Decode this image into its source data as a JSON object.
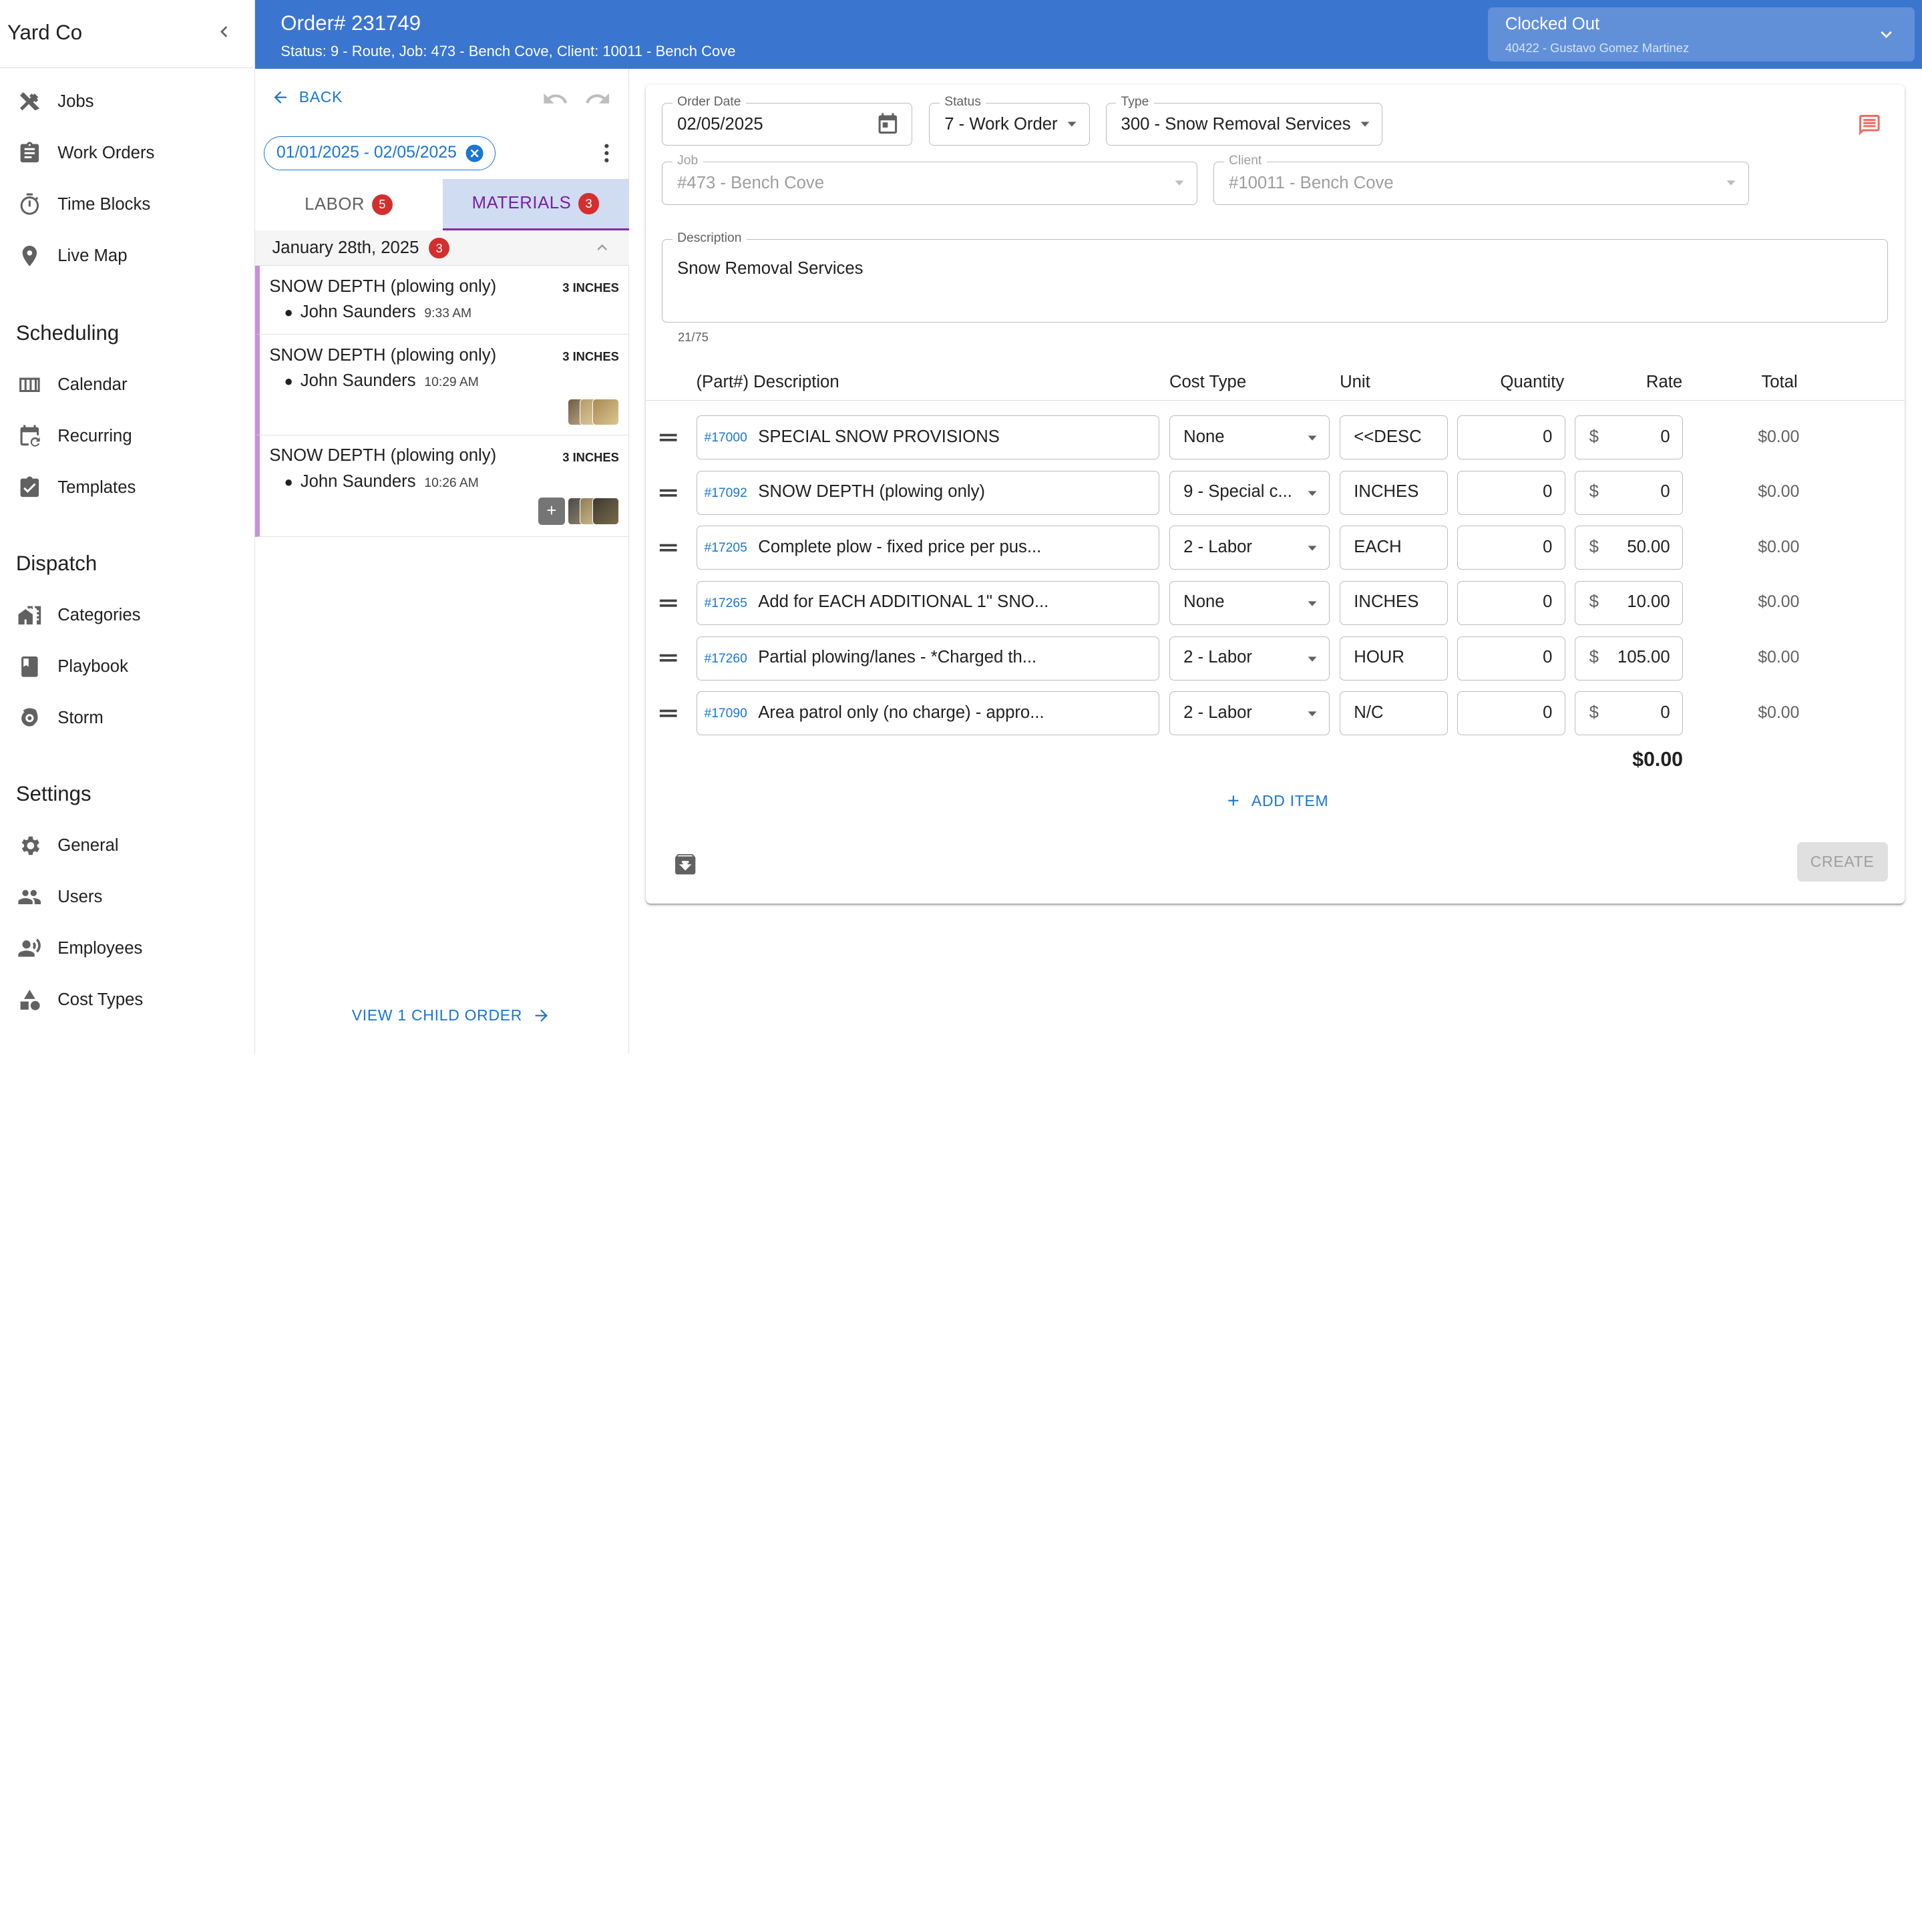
{
  "sidebar": {
    "brand": "Yard Co",
    "items_top": [
      {
        "label": "Jobs",
        "icon": "tools-icon"
      },
      {
        "label": "Work Orders",
        "icon": "clipboard-icon"
      },
      {
        "label": "Time Blocks",
        "icon": "stopwatch-icon"
      },
      {
        "label": "Live Map",
        "icon": "map-pin-icon"
      }
    ],
    "scheduling": {
      "heading": "Scheduling",
      "items": [
        {
          "label": "Calendar",
          "icon": "calendar-view-icon"
        },
        {
          "label": "Recurring",
          "icon": "calendar-repeat-icon"
        },
        {
          "label": "Templates",
          "icon": "template-icon"
        }
      ]
    },
    "dispatch": {
      "heading": "Dispatch",
      "items": [
        {
          "label": "Categories",
          "icon": "categories-icon"
        },
        {
          "label": "Playbook",
          "icon": "book-icon"
        },
        {
          "label": "Storm",
          "icon": "storm-icon"
        }
      ]
    },
    "settings": {
      "heading": "Settings",
      "items": [
        {
          "label": "General",
          "icon": "gear-icon"
        },
        {
          "label": "Users",
          "icon": "users-icon"
        },
        {
          "label": "Employees",
          "icon": "employees-icon"
        },
        {
          "label": "Cost Types",
          "icon": "shapes-icon"
        }
      ]
    }
  },
  "header": {
    "title": "Order# 231749",
    "subtitle": "Status: 9 - Route, Job: 473 - Bench Cove, Client: 10011 - Bench Cove",
    "clock_status": "Clocked Out",
    "clock_user": "40422 - Gustavo Gomez Martinez"
  },
  "left_panel": {
    "back_label": "BACK",
    "date_range": "01/01/2025 - 02/05/2025",
    "tabs": [
      {
        "label": "LABOR",
        "count": "5"
      },
      {
        "label": "MATERIALS",
        "count": "3"
      }
    ],
    "group": {
      "label": "January 28th, 2025",
      "count": "3"
    },
    "materials": [
      {
        "title": "SNOW DEPTH (plowing only)",
        "qty": "3 INCHES",
        "who": "John Saunders",
        "time": "9:33 AM"
      },
      {
        "title": "SNOW DEPTH (plowing only)",
        "qty": "3 INCHES",
        "who": "John Saunders",
        "time": "10:29 AM"
      },
      {
        "title": "SNOW DEPTH (plowing only)",
        "qty": "3 INCHES",
        "who": "John Saunders",
        "time": "10:26 AM"
      }
    ],
    "plus_label": "+",
    "child_order_label": "VIEW 1 CHILD ORDER"
  },
  "form": {
    "order_date": {
      "label": "Order Date",
      "value": "02/05/2025"
    },
    "status": {
      "label": "Status",
      "value": "7 - Work Order"
    },
    "type": {
      "label": "Type",
      "value": "300 - Snow Removal Services"
    },
    "job": {
      "label": "Job",
      "value": "#473 - Bench Cove"
    },
    "client": {
      "label": "Client",
      "value": "#10011 - Bench Cove"
    },
    "description": {
      "label": "Description",
      "value": "Snow Removal Services",
      "counter": "21/75"
    }
  },
  "table": {
    "headers": {
      "desc": "(Part#) Description",
      "cost_type": "Cost Type",
      "unit": "Unit",
      "quantity": "Quantity",
      "rate": "Rate",
      "total": "Total"
    },
    "currency": "$",
    "rows": [
      {
        "part": "#17000",
        "desc": "SPECIAL SNOW PROVISIONS",
        "cost_type": "None",
        "unit": "<<DESC",
        "qty": "0",
        "rate": "0",
        "total": "$0.00"
      },
      {
        "part": "#17092",
        "desc": "SNOW DEPTH (plowing only)",
        "cost_type": "9 - Special c...",
        "unit": "INCHES",
        "qty": "0",
        "rate": "0",
        "total": "$0.00"
      },
      {
        "part": "#17205",
        "desc": "Complete plow - fixed price per pus...",
        "cost_type": "2 - Labor",
        "unit": "EACH",
        "qty": "0",
        "rate": "50.00",
        "total": "$0.00"
      },
      {
        "part": "#17265",
        "desc": "Add for EACH ADDITIONAL 1\" SNO...",
        "cost_type": "None",
        "unit": "INCHES",
        "qty": "0",
        "rate": "10.00",
        "total": "$0.00"
      },
      {
        "part": "#17260",
        "desc": "Partial plowing/lanes - *Charged th...",
        "cost_type": "2 - Labor",
        "unit": "HOUR",
        "qty": "0",
        "rate": "105.00",
        "total": "$0.00"
      },
      {
        "part": "#17090",
        "desc": "Area patrol only (no charge) - appro...",
        "cost_type": "2 - Labor",
        "unit": "N/C",
        "qty": "0",
        "rate": "0",
        "total": "$0.00"
      }
    ],
    "grand_total": "$0.00",
    "add_item_label": "ADD ITEM",
    "create_label": "CREATE"
  },
  "colors": {
    "header_bg": "#3a75d0",
    "accent": "#1976d2",
    "materials_tab": "#7b1fa2",
    "badge": "#d32f2f",
    "item_border": "#c98ed8"
  }
}
